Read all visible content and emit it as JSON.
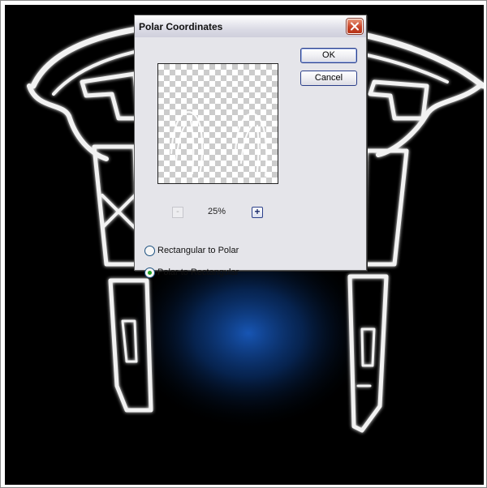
{
  "dialog": {
    "title": "Polar Coordinates",
    "ok_label": "OK",
    "cancel_label": "Cancel",
    "zoom": {
      "minus_label": "-",
      "level": "25%",
      "plus_label": "+"
    },
    "options": [
      {
        "label": "Rectangular to Polar",
        "selected": false
      },
      {
        "label": "Polar to Rectangular",
        "selected": true
      }
    ]
  },
  "colors": {
    "canvas_background": "#000000",
    "glow": "#0a3e8c",
    "radio_selected": "#21a121"
  },
  "icons": {
    "close": "close-x-icon",
    "radio": "radio-icon"
  }
}
